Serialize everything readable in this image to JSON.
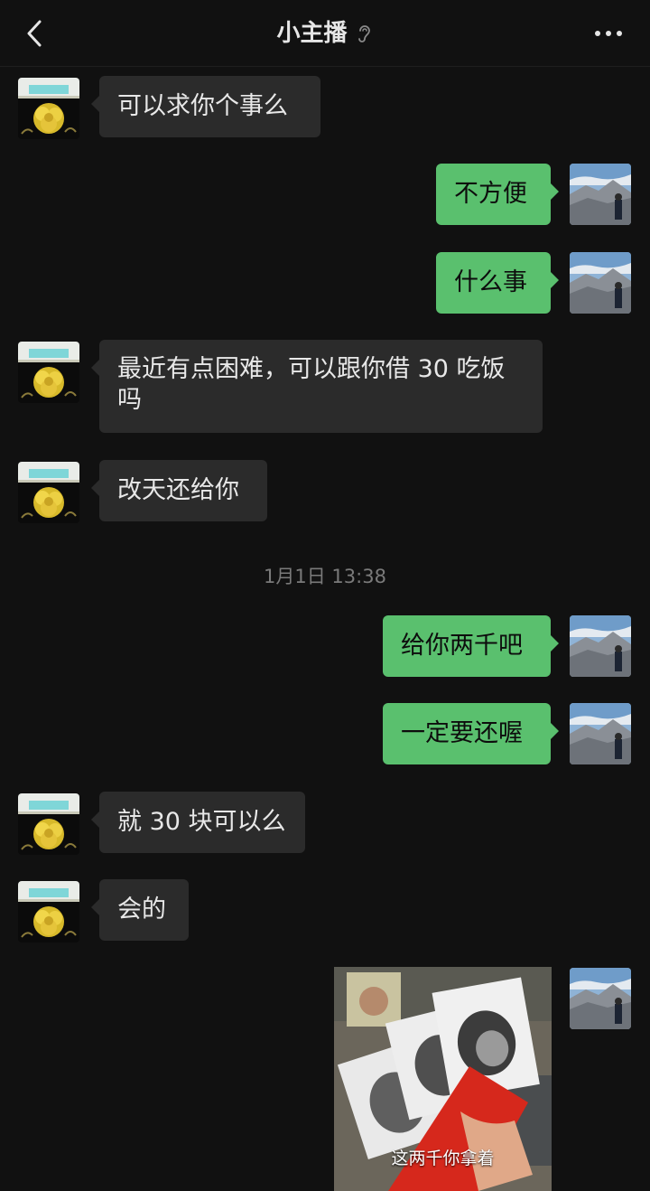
{
  "header": {
    "title": "小主播",
    "back_icon": "chevron-left-icon",
    "mute_icon": "mute-ear-icon",
    "more_icon": "ellipsis-icon"
  },
  "messages": [
    {
      "side": "in",
      "text": "可以求你个事么"
    },
    {
      "side": "out",
      "text": "不方便"
    },
    {
      "side": "out",
      "text": "什么事"
    },
    {
      "side": "in",
      "text": "最近有点困难，可以跟你借 30 吃饭吗"
    },
    {
      "side": "in",
      "text": "改天还给你"
    },
    {
      "side": "out",
      "text": "给你两千吧"
    },
    {
      "side": "out",
      "text": "一定要还喔"
    },
    {
      "side": "in",
      "text": "就 30 块可以么"
    },
    {
      "side": "in",
      "text": "会的"
    }
  ],
  "timestamp": "1月1日 13:38",
  "image_message": {
    "side": "out",
    "caption": "这两千你拿着"
  },
  "colors": {
    "background": "#111111",
    "incoming_bubble": "#2b2b2b",
    "outgoing_bubble": "#5ac06e"
  }
}
